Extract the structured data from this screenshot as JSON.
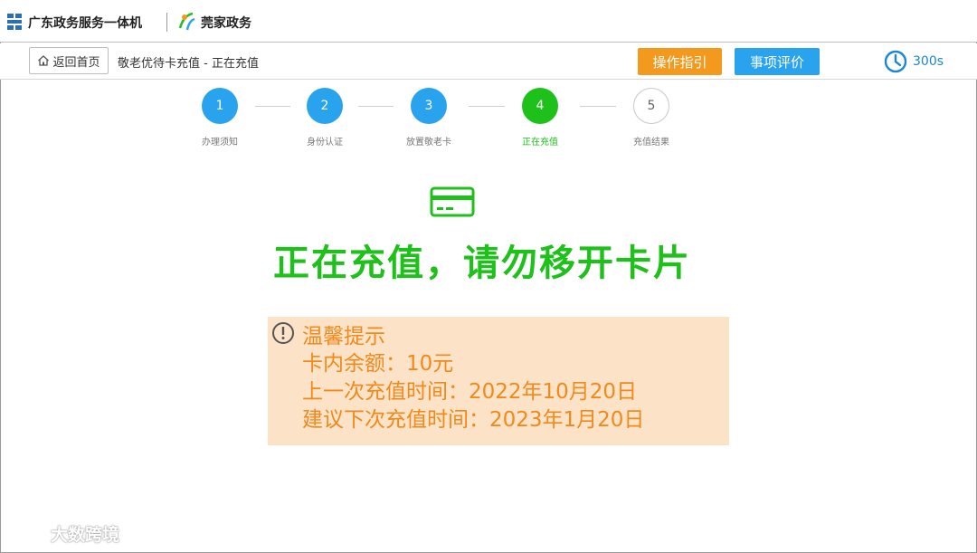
{
  "brand": {
    "primary_name": "广东政务服务一体机",
    "secondary_name": "莞家政务"
  },
  "nav": {
    "home_label": "返回首页",
    "breadcrumb": "敬老优待卡充值 - 正在充值",
    "guide_label": "操作指引",
    "rate_label": "事项评价",
    "timer": "300s"
  },
  "steps": [
    {
      "num": "1",
      "label": "办理须知",
      "state": "done"
    },
    {
      "num": "2",
      "label": "身份认证",
      "state": "done"
    },
    {
      "num": "3",
      "label": "放置敬老卡",
      "state": "done"
    },
    {
      "num": "4",
      "label": "正在充值",
      "state": "active"
    },
    {
      "num": "5",
      "label": "充值结果",
      "state": "todo"
    }
  ],
  "main": {
    "headline": "正在充值，请勿移开卡片"
  },
  "tip": {
    "title": "温馨提示",
    "balance": "卡内余额：10元",
    "last_recharge": "上一次充值时间：2022年10月20日",
    "next_recharge": "建议下次充值时间：2023年1月20日"
  },
  "watermark": "大数跨境",
  "colors": {
    "blue": "#2aa3ef",
    "green": "#1ec01a",
    "orange": "#f39a1e",
    "tip_bg": "#fce3c8",
    "tip_text": "#f08a1c"
  }
}
